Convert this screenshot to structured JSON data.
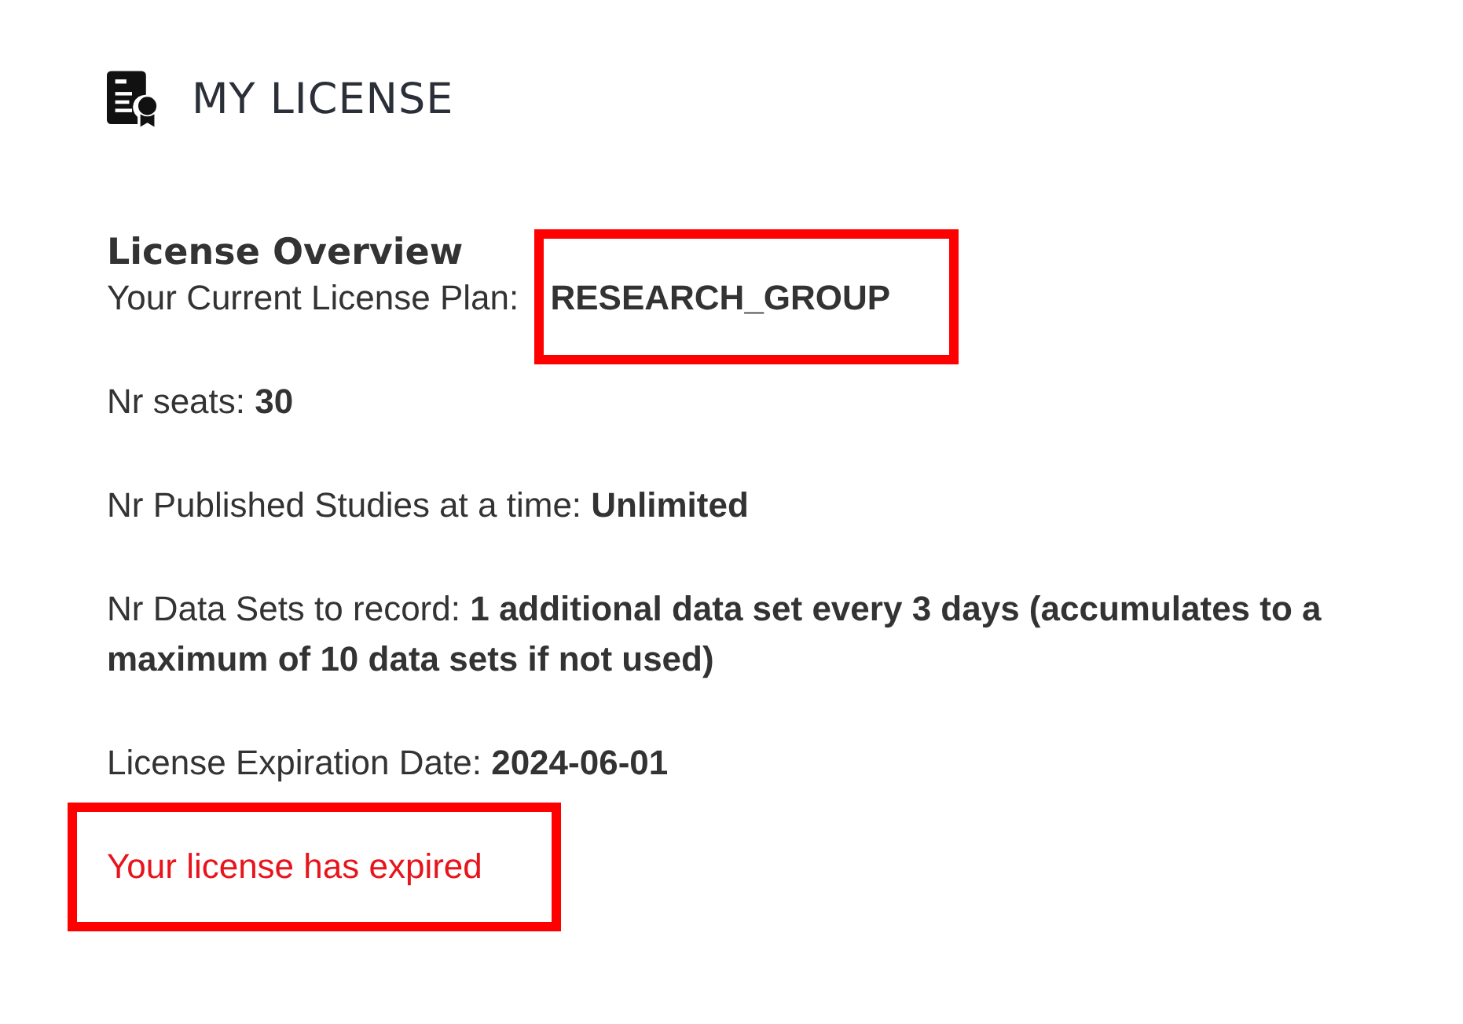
{
  "page": {
    "title": "MY LICENSE"
  },
  "overview": {
    "heading": "License Overview",
    "items": [
      {
        "label": "Your Current License Plan:",
        "value": "RESEARCH_GROUP",
        "highlighted": true
      },
      {
        "label": "Nr seats:",
        "value": "30",
        "highlighted": false
      },
      {
        "label": "Nr Published Studies at a time:",
        "value": "Unlimited",
        "highlighted": false
      },
      {
        "label": "Nr Data Sets to record:",
        "value": "1 additional data set every 3 days (accumulates to a maximum of 10 data sets if not used)",
        "highlighted": false
      },
      {
        "label": "License Expiration Date:",
        "value": "2024-06-01",
        "highlighted": false
      }
    ],
    "status_message": {
      "text": "Your license has expired",
      "highlighted": true
    }
  }
}
